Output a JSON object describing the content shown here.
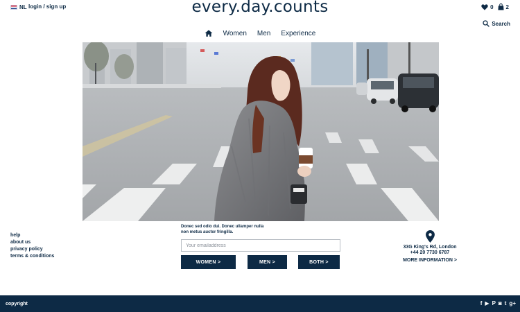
{
  "header": {
    "language": "NL",
    "login_label": "login / sign up",
    "logo": "every.day.counts",
    "wishlist_count": "0",
    "cart_count": "2",
    "search_label": "Search"
  },
  "nav": {
    "items": [
      {
        "label": "Women"
      },
      {
        "label": "Men"
      },
      {
        "label": "Experience"
      }
    ]
  },
  "hero": {
    "icon": "woman-crossing-street-photo"
  },
  "footer_links": [
    {
      "label": "help"
    },
    {
      "label": "about us"
    },
    {
      "label": "privacy policy"
    },
    {
      "label": "terms & conditions"
    }
  ],
  "newsletter": {
    "text": "Donec sed odio dui. Donec ullamper nulla non metus auctor fringilla.",
    "email_placeholder": "Your emailaddress",
    "buttons": [
      "WOMEN >",
      "MEN >",
      "BOTH >"
    ]
  },
  "address": {
    "street": "33G King's Rd, London",
    "phone": "+44 20 7730 6787",
    "more_label": "MORE INFORMATION >"
  },
  "footer": {
    "copyright": "copyright",
    "social_icons": [
      "facebook-icon",
      "youtube-icon",
      "pinterest-icon",
      "instagram-icon",
      "twitter-icon",
      "google-plus-icon"
    ]
  },
  "colors": {
    "brand": "#0d2a45",
    "background": "#ffffff"
  }
}
